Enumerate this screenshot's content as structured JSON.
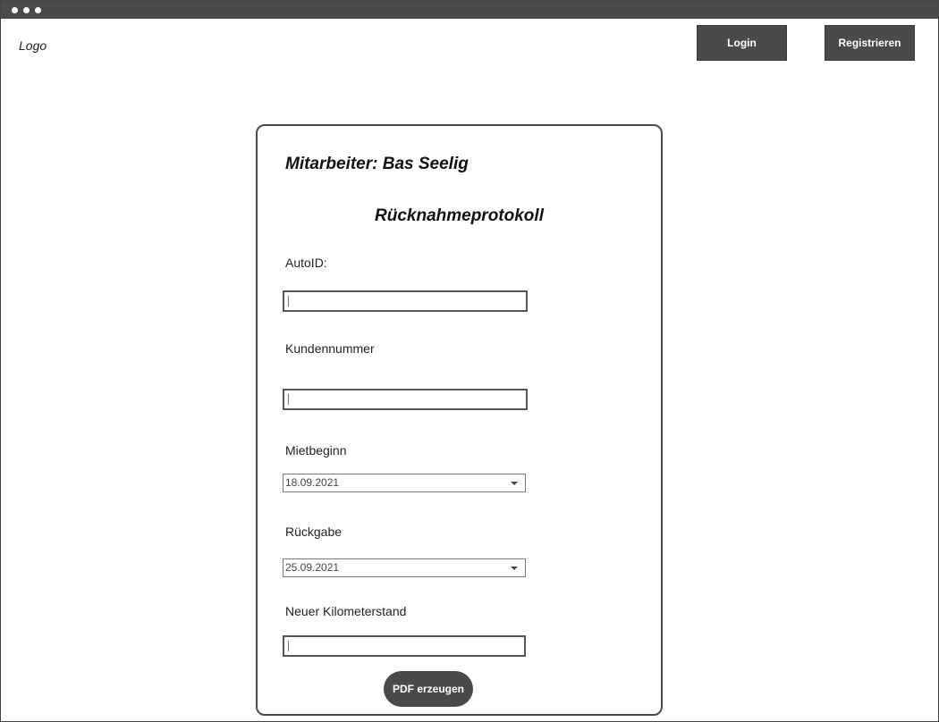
{
  "header": {
    "logo_text": "Logo",
    "login_label": "Login",
    "register_label": "Registrieren"
  },
  "form": {
    "employee_line": "Mitarbeiter: Bas Seelig",
    "title": "Rücknahmeprotokoll",
    "auto_id_label": "AutoID:",
    "auto_id_value": "",
    "customer_number_label": "Kundennummer",
    "customer_number_value": "",
    "rental_start_label": "Mietbeginn",
    "rental_start_value": "18.09.2021",
    "return_label": "Rückgabe",
    "return_value": "25.09.2021",
    "new_mileage_label": "Neuer Kilometerstand",
    "new_mileage_value": "",
    "pdf_button_label": "PDF erzeugen"
  }
}
